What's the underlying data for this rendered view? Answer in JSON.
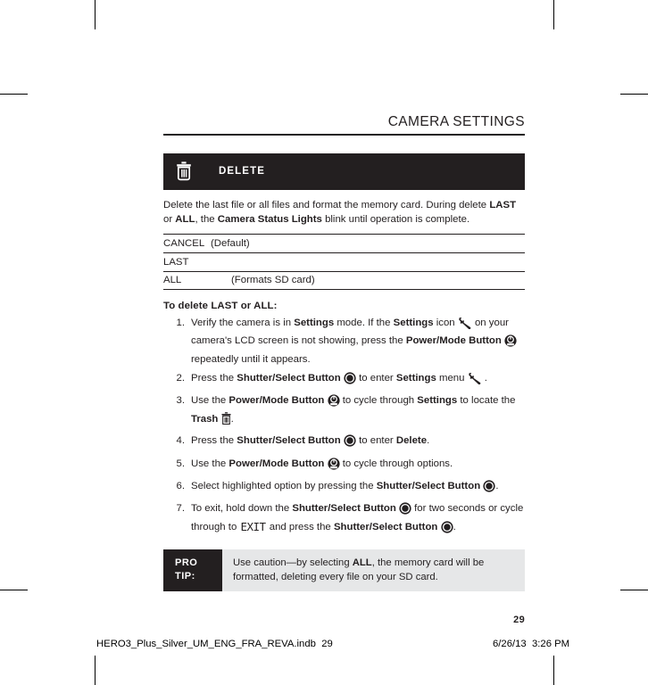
{
  "page": {
    "running_head": "CAMERA SETTINGS",
    "folio": "29"
  },
  "section": {
    "icon": "trash-icon",
    "title": "DELETE",
    "description_parts": {
      "p1": "Delete the last file or all files and format the memory card. During delete ",
      "b1": "LAST",
      "p2": " or ",
      "b2": "ALL",
      "p3": ", the ",
      "b3": "Camera Status Lights",
      "p4": " blink until operation is complete."
    }
  },
  "options": [
    {
      "name": "CANCEL",
      "note": "(Default)",
      "indent": false
    },
    {
      "name": "LAST",
      "note": "",
      "indent": false
    },
    {
      "name": "ALL",
      "note": "(Formats SD card)",
      "indent": true
    }
  ],
  "procedure": {
    "title": "To delete LAST or ALL:",
    "steps": [
      {
        "num": "1.",
        "parts": [
          {
            "t": "Verify the camera is in "
          },
          {
            "t": "Settings",
            "b": true
          },
          {
            "t": " mode. If the "
          },
          {
            "t": "Settings",
            "b": true
          },
          {
            "t": " icon "
          },
          {
            "icon": "wrench-icon"
          },
          {
            "t": " on your camera's LCD screen is not showing, press the "
          },
          {
            "t": "Power/Mode Button",
            "b": true
          },
          {
            "t": " "
          },
          {
            "icon": "power-mode-button-icon"
          },
          {
            "t": " repeatedly until it appears."
          }
        ]
      },
      {
        "num": "2.",
        "parts": [
          {
            "t": "Press the "
          },
          {
            "t": "Shutter/Select Button",
            "b": true
          },
          {
            "t": " "
          },
          {
            "icon": "shutter-select-button-icon"
          },
          {
            "t": " to enter "
          },
          {
            "t": "Settings",
            "b": true
          },
          {
            "t": " menu "
          },
          {
            "icon": "wrench-icon"
          },
          {
            "t": " ."
          }
        ]
      },
      {
        "num": "3.",
        "parts": [
          {
            "t": "Use the "
          },
          {
            "t": "Power/Mode Button",
            "b": true
          },
          {
            "t": " "
          },
          {
            "icon": "power-mode-button-icon"
          },
          {
            "t": " to cycle through "
          },
          {
            "t": "Settings",
            "b": true
          },
          {
            "t": " to locate the "
          },
          {
            "t": "Trash",
            "b": true
          },
          {
            "t": " "
          },
          {
            "icon": "trash-icon-small"
          },
          {
            "t": "."
          }
        ]
      },
      {
        "num": "4.",
        "parts": [
          {
            "t": "Press the "
          },
          {
            "t": "Shutter/Select Button",
            "b": true
          },
          {
            "t": " "
          },
          {
            "icon": "shutter-select-button-icon"
          },
          {
            "t": " to enter "
          },
          {
            "t": "Delete",
            "b": true
          },
          {
            "t": "."
          }
        ]
      },
      {
        "num": "5.",
        "parts": [
          {
            "t": "Use the "
          },
          {
            "t": "Power/Mode Button",
            "b": true
          },
          {
            "t": " "
          },
          {
            "icon": "power-mode-button-icon"
          },
          {
            "t": " to cycle through options."
          }
        ]
      },
      {
        "num": "6.",
        "parts": [
          {
            "t": "Select highlighted option by pressing the "
          },
          {
            "t": "Shutter/Select Button",
            "b": true
          },
          {
            "t": " "
          },
          {
            "icon": "shutter-select-button-icon"
          },
          {
            "t": "."
          }
        ]
      },
      {
        "num": "7.",
        "parts": [
          {
            "t": "To exit, hold down the "
          },
          {
            "t": "Shutter/Select Button",
            "b": true
          },
          {
            "t": " "
          },
          {
            "icon": "shutter-select-button-icon"
          },
          {
            "t": " for two seconds or cycle through to "
          },
          {
            "t": "EXIT",
            "lcd": true
          },
          {
            "t": " and press the "
          },
          {
            "t": "Shutter/Select Button",
            "b": true
          },
          {
            "t": " "
          },
          {
            "icon": "shutter-select-button-icon"
          },
          {
            "t": "."
          }
        ]
      }
    ]
  },
  "pro_tip": {
    "label_line1": "PRO",
    "label_line2": "TIP:",
    "body_parts": {
      "p1": "Use caution—by selecting ",
      "b1": "ALL",
      "p2": ", the memory card will be formatted, deleting every file on your SD card."
    }
  },
  "print_slug": {
    "filename": "HERO3_Plus_Silver_UM_ENG_FRA_REVA.indb",
    "page": "29",
    "date": "6/26/13",
    "time": "3:26 PM"
  },
  "colors": {
    "ink": "#231f20",
    "header_bg": "#231f20",
    "protip_bg": "#e6e7e8",
    "paper": "#ffffff"
  }
}
